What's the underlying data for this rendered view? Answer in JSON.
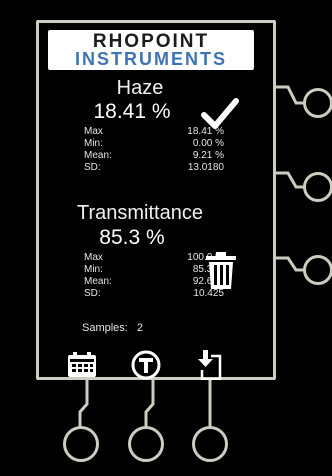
{
  "logo": {
    "line1": "RHOPOINT",
    "line2": "INSTRUMENTS"
  },
  "haze": {
    "title": "Haze",
    "value": "18.41 %",
    "stats": [
      {
        "label": "Max",
        "value": "18.41 %"
      },
      {
        "label": "Min:",
        "value": "0.00 %"
      },
      {
        "label": "Mean:",
        "value": "9.21 %"
      },
      {
        "label": "SD:",
        "value": "13.0180"
      }
    ]
  },
  "transmittance": {
    "title": "Transmittance",
    "value": "85.3 %",
    "stats": [
      {
        "label": "Max",
        "value": "100.0 %"
      },
      {
        "label": "Min:",
        "value": "85.3 %"
      },
      {
        "label": "Mean:",
        "value": "92.6 %"
      },
      {
        "label": "SD:",
        "value": "10.425"
      }
    ]
  },
  "samples": {
    "label": "Samples:",
    "count": "2"
  },
  "icons": {
    "confirm": "checkmark-icon",
    "delete": "trash-icon",
    "calendar": "calendar-icon",
    "transmittance_mode": "t-circle-icon",
    "export": "download-document-icon"
  },
  "colors": {
    "background": "#000000",
    "frame": "#c8cfc0",
    "logo_dark": "#1c1c1c",
    "logo_blue": "#3f74b4",
    "text": "#f2f2f2"
  }
}
